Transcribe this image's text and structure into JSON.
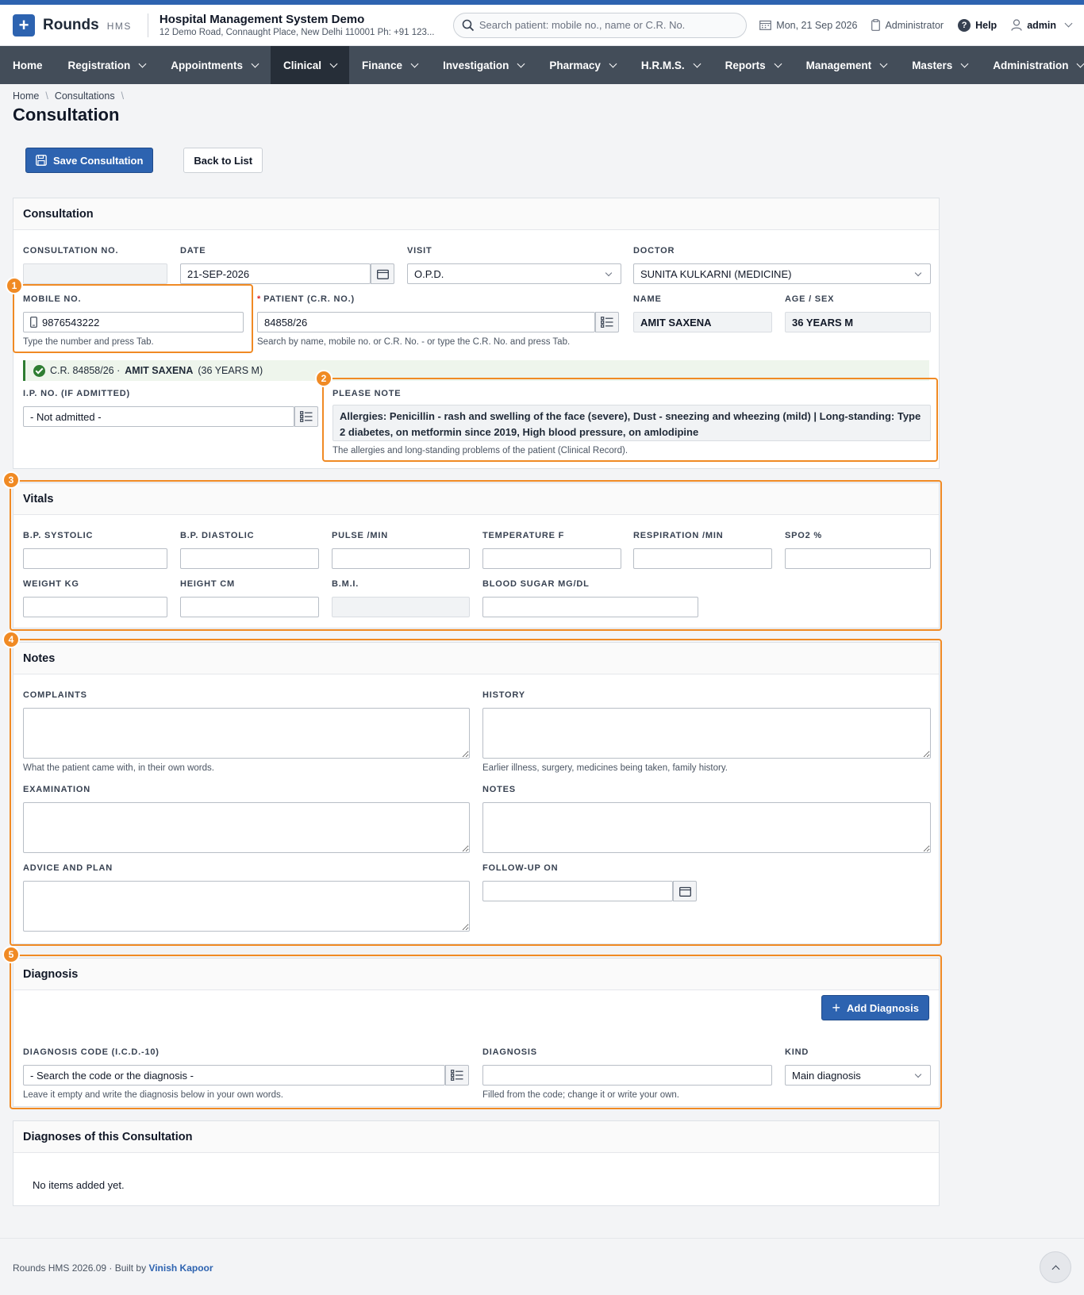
{
  "header": {
    "brand": "Rounds",
    "brand_sub": "HMS",
    "org_title": "Hospital Management System Demo",
    "org_address": "12 Demo Road, Connaught Place, New Delhi 110001 Ph: +91 123...",
    "search_placeholder": "Search patient: mobile no., name or C.R. No.",
    "date": "Mon, 21 Sep 2026",
    "role": "Administrator",
    "help": "Help",
    "user": "admin"
  },
  "nav": {
    "items": [
      "Home",
      "Registration",
      "Appointments",
      "Clinical",
      "Finance",
      "Investigation",
      "Pharmacy",
      "H.R.M.S.",
      "Reports",
      "Management",
      "Masters",
      "Administration"
    ],
    "active": "Clinical"
  },
  "breadcrumb": [
    "Home",
    "Consultations"
  ],
  "page_title": "Consultation",
  "actions": {
    "save": "Save Consultation",
    "back": "Back to List"
  },
  "consultation": {
    "title": "Consultation",
    "labels": {
      "consultation_no": "Consultation No.",
      "date": "Date",
      "visit": "Visit",
      "doctor": "Doctor",
      "mobile": "Mobile No.",
      "patient": "Patient (C.R. No.)",
      "name": "Name",
      "age_sex": "Age / Sex",
      "ip_no": "I.P. No. (if admitted)",
      "please_note": "Please Note"
    },
    "values": {
      "consultation_no": "",
      "date": "21-SEP-2026",
      "visit": "O.P.D.",
      "doctor": "SUNITA KULKARNI (MEDICINE)",
      "mobile": "9876543222",
      "patient": "84858/26",
      "name": "AMIT SAXENA",
      "age_sex": "36 YEARS M",
      "ip_no": "- Not admitted -",
      "please_note": "Allergies: Penicillin - rash and swelling of the face (severe), Dust - sneezing and wheezing (mild) | Long-standing: Type 2 diabetes, on metformin since 2019, High blood pressure, on amlodipine"
    },
    "help": {
      "mobile": "Type the number and press Tab.",
      "patient": "Search by name, mobile no. or C.R. No. - or type the C.R. No. and press Tab.",
      "please_note": "The allergies and long-standing problems of the patient (Clinical Record)."
    },
    "found": {
      "prefix": "C.R. 84858/26 ·",
      "name": "AMIT SAXENA",
      "suffix": "(36 YEARS M)"
    }
  },
  "vitals": {
    "title": "Vitals",
    "labels": {
      "bp_systolic": "B.P. Systolic",
      "bp_diastolic": "B.P. Diastolic",
      "pulse": "Pulse /min",
      "temperature": "Temperature F",
      "respiration": "Respiration /min",
      "spo2": "SpO2 %",
      "weight": "Weight kg",
      "height": "Height cm",
      "bmi": "B.M.I.",
      "blood_sugar": "Blood Sugar mg/dL"
    }
  },
  "notes": {
    "title": "Notes",
    "labels": {
      "complaints": "Complaints",
      "history": "History",
      "examination": "Examination",
      "notes": "Notes",
      "advice": "Advice and Plan",
      "follow_up": "Follow-up On"
    },
    "help": {
      "complaints": "What the patient came with, in their own words.",
      "history": "Earlier illness, surgery, medicines being taken, family history."
    }
  },
  "diagnosis": {
    "title": "Diagnosis",
    "add_button": "Add Diagnosis",
    "labels": {
      "code": "Diagnosis Code (I.C.D.-10)",
      "diagnosis": "Diagnosis",
      "kind": "Kind"
    },
    "values": {
      "code": "- Search the code or the diagnosis -",
      "kind": "Main diagnosis"
    },
    "help": {
      "code": "Leave it empty and write the diagnosis below in your own words.",
      "diagnosis": "Filled from the code; change it or write your own."
    }
  },
  "diagnoses_list": {
    "title": "Diagnoses of this Consultation",
    "empty": "No items added yet."
  },
  "footer": {
    "text": "Rounds HMS 2026.09 · Built by",
    "author": "Vinish Kapoor"
  },
  "highlights": [
    "1",
    "2",
    "3",
    "4",
    "5"
  ],
  "colors": {
    "primary": "#2d63b0",
    "nav": "#434d59",
    "nav_active": "#262e38",
    "highlight": "#f08a24",
    "success": "#2e7d32"
  }
}
